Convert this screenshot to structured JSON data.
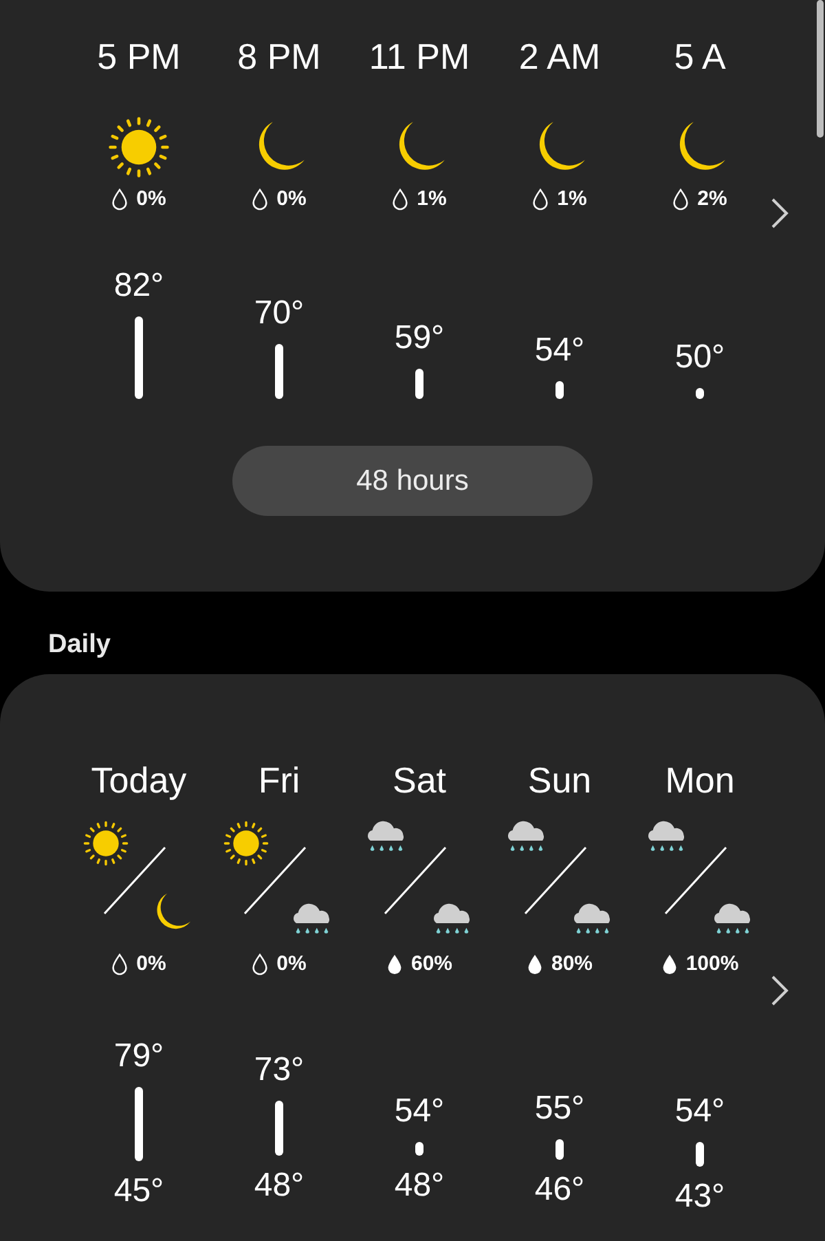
{
  "hourly": {
    "items": [
      {
        "time": "5 PM",
        "kind": "sun",
        "precip": {
          "kind": "outline",
          "text": "0%"
        },
        "temp": "82°"
      },
      {
        "time": "8 PM",
        "kind": "moon",
        "precip": {
          "kind": "outline",
          "text": "0%"
        },
        "temp": "70°"
      },
      {
        "time": "11 PM",
        "kind": "moon",
        "precip": {
          "kind": "outline",
          "text": "1%"
        },
        "temp": "59°"
      },
      {
        "time": "2 AM",
        "kind": "moon",
        "precip": {
          "kind": "outline",
          "text": "1%"
        },
        "temp": "54°"
      },
      {
        "time": "5 A",
        "kind": "moon",
        "precip": {
          "kind": "outline",
          "text": "2%"
        },
        "temp": "50°"
      }
    ],
    "button": "48 hours"
  },
  "daily_heading": "Daily",
  "daily": {
    "items": [
      {
        "day": "Today",
        "icons": [
          {
            "kind": "sun"
          },
          {
            "kind": "moon"
          }
        ],
        "precip": {
          "kind": "outline",
          "text": "0%"
        },
        "high": "79°",
        "low": "45°"
      },
      {
        "day": "Fri",
        "icons": [
          {
            "kind": "sun"
          },
          {
            "kind": "rain"
          }
        ],
        "precip": {
          "kind": "outline",
          "text": "0%"
        },
        "high": "73°",
        "low": "48°"
      },
      {
        "day": "Sat",
        "icons": [
          {
            "kind": "rain"
          },
          {
            "kind": "rain"
          }
        ],
        "precip": {
          "kind": "filled",
          "text": "60%"
        },
        "high": "54°",
        "low": "48°"
      },
      {
        "day": "Sun",
        "icons": [
          {
            "kind": "rain"
          },
          {
            "kind": "rain"
          }
        ],
        "precip": {
          "kind": "filled",
          "text": "80%"
        },
        "high": "55°",
        "low": "46°"
      },
      {
        "day": "Mon",
        "icons": [
          {
            "kind": "rain"
          },
          {
            "kind": "rain"
          }
        ],
        "precip": {
          "kind": "filled",
          "text": "100%"
        },
        "high": "54°",
        "low": "43°"
      }
    ]
  }
}
